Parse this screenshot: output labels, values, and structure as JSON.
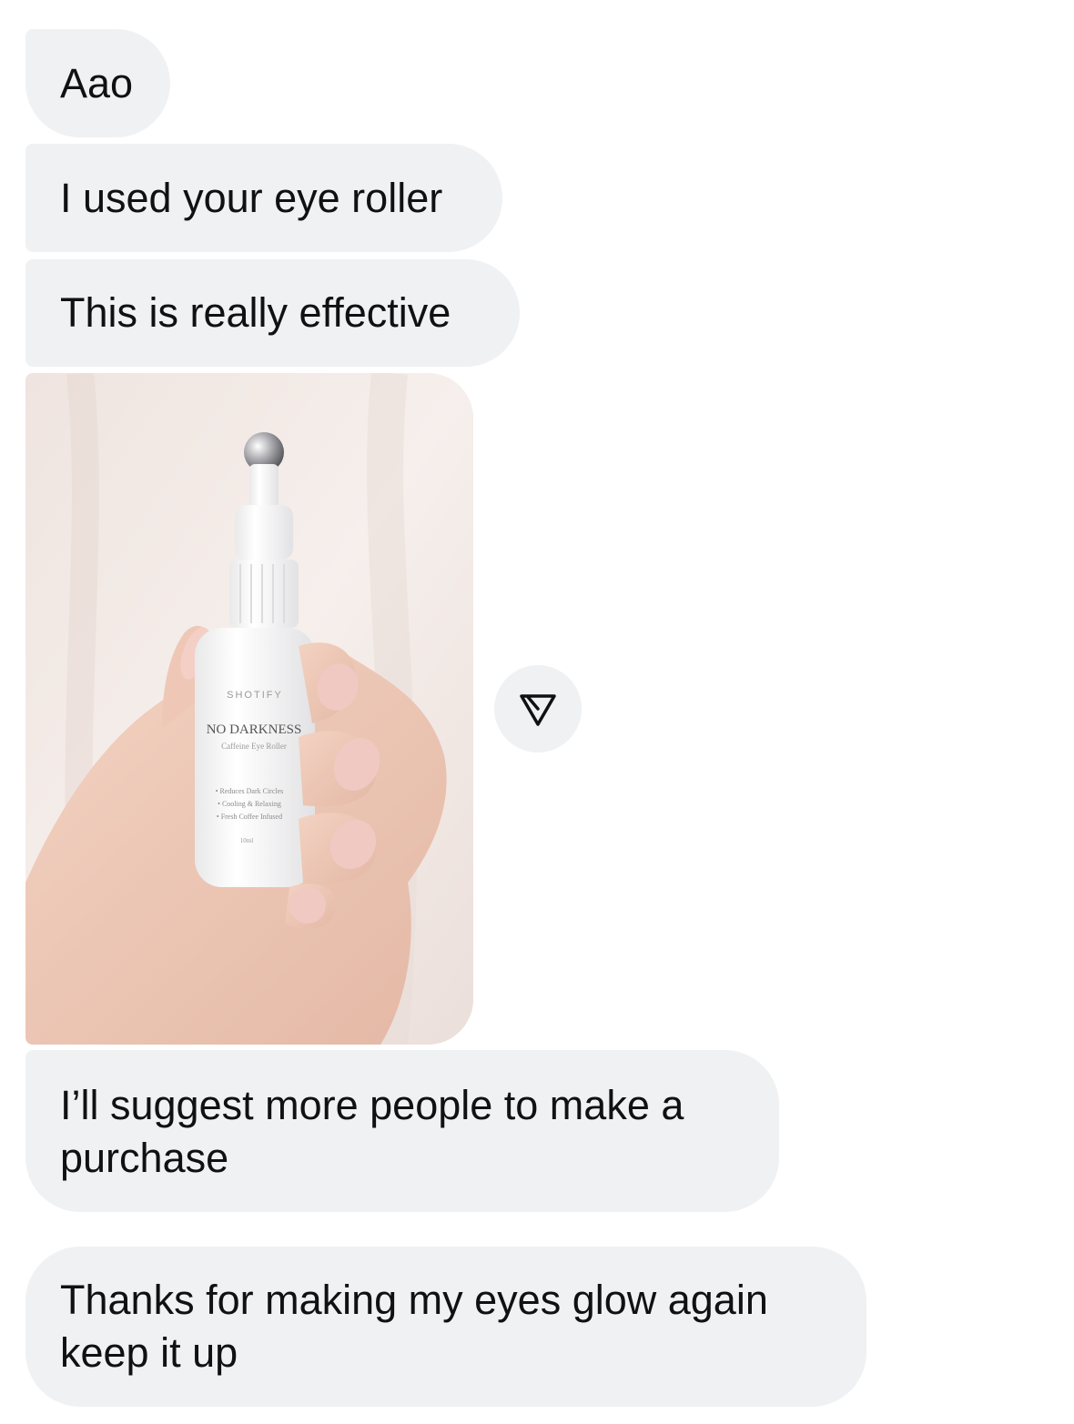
{
  "messages": [
    {
      "text": "Aao"
    },
    {
      "text": "I used your eye roller"
    },
    {
      "text": "This is really effective"
    },
    {
      "text_lines": [
        "I’ll suggest more people to make a",
        "purchase"
      ]
    },
    {
      "text_lines": [
        "Thanks for making my eyes glow again",
        "keep it up"
      ]
    }
  ],
  "photo": {
    "brand": "SHOTIFY",
    "product_name": "NO DARKNESS",
    "product_subtitle": "Caffeine Eye Roller",
    "features": [
      "• Reduces Dark Circles",
      "• Cooling & Relaxing",
      "• Fresh Coffee Infused"
    ],
    "volume": "10ml"
  },
  "icons": {
    "share": "share-send-icon"
  },
  "colors": {
    "bubble_bg": "#f0f1f3",
    "text": "#111111"
  }
}
